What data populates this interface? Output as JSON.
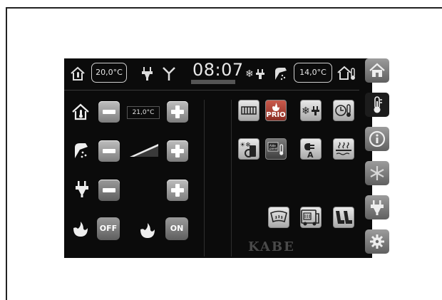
{
  "status_bar": {
    "indoor_temp": "20,0°C",
    "clock": "08:07",
    "outdoor_temp": "14,0°C",
    "icons": [
      "home-thermometer-icon",
      "plug-icon",
      "antenna-icon",
      "snow-plug-icon",
      "shower-icon",
      "outdoor-thermometer-icon"
    ]
  },
  "controls": {
    "heating": {
      "icon": "home-thermometer-icon",
      "value": "21,0°C"
    },
    "hot_water": {
      "icon": "shower-icon",
      "level_fraction": 0.5
    },
    "electric": {
      "icon": "plug-icon"
    },
    "gas": {
      "off_label": "OFF",
      "on_label": "ON"
    }
  },
  "functions": {
    "row1": [
      "radiator-icon",
      "prio-flame-icon",
      "snow-plug-icon",
      "thermostat-clock-icon"
    ],
    "prio_label": "PRIO",
    "row2": [
      "timer-power-icon",
      "alde-panel-icon",
      "auto-electric-icon",
      "floor-heating-icon"
    ],
    "row3": [
      "windshield-heater-icon",
      "van-heater-icon",
      "seat-heater-icon"
    ]
  },
  "brand": "KABE",
  "side_menu": [
    "home-icon",
    "thermometer-icon",
    "info-icon",
    "snowflake-icon",
    "plug-icon",
    "gear-icon"
  ],
  "colors": {
    "screen_bg": "#0b0b0b",
    "button_gray": "#9a9a9a",
    "tile_light": "#e0e0e0"
  }
}
